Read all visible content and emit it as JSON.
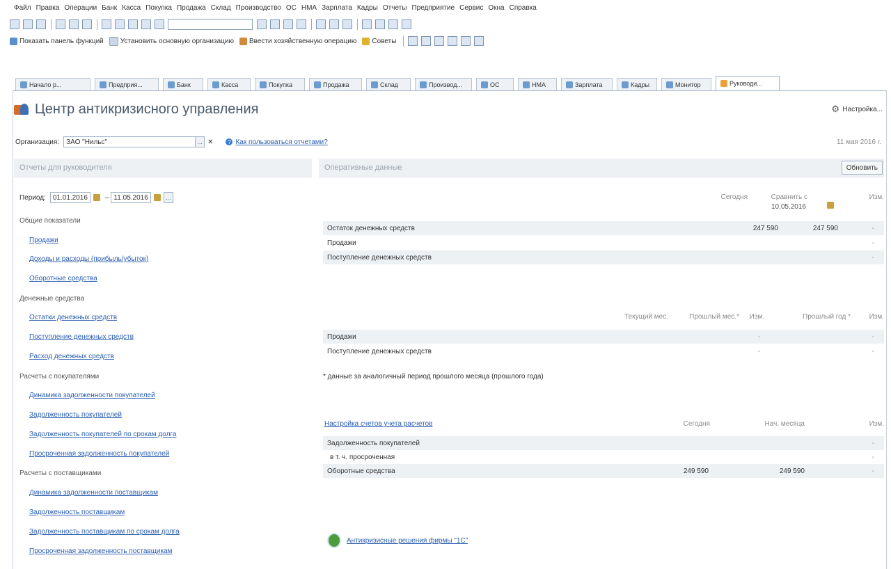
{
  "menu": [
    "Файл",
    "Правка",
    "Операции",
    "Банк",
    "Касса",
    "Покупка",
    "Продажа",
    "Склад",
    "Производство",
    "ОС",
    "НМА",
    "Зарплата",
    "Кадры",
    "Отчеты",
    "Предприятие",
    "Сервис",
    "Окна",
    "Справка"
  ],
  "toolbar2": {
    "show_panel": "Показать панель функций",
    "set_org": "Установить основную организацию",
    "enter_op": "Ввести хозяйственную операцию",
    "tips": "Советы"
  },
  "tabs": [
    "Начало р...",
    "Предприя...",
    "Банк",
    "Касса",
    "Покупка",
    "Продажа",
    "Склад",
    "Производ...",
    "ОС",
    "НМА",
    "Зарплата",
    "Кадры",
    "Монитор",
    "Руководи..."
  ],
  "header": {
    "title": "Центр антикризисного управления",
    "settings": "Настройка..."
  },
  "org": {
    "label": "Организация:",
    "value": "ЗАО \"Нильс\"",
    "help_link": "Как пользоваться отчетами?",
    "date": "11 мая 2016 г."
  },
  "left": {
    "title": "Отчеты для руководителя",
    "period_label": "Период:",
    "period_from": "01.01.2016",
    "period_to": "11.05.2016",
    "sections": [
      {
        "title": "Общие показатели",
        "links": [
          "Продажи",
          "Доходы и расходы (прибыль/убыток)",
          "Оборотные средства"
        ]
      },
      {
        "title": "Денежные средства",
        "links": [
          "Остатки денежных средств",
          "Поступление денежных средств",
          "Расход денежных средств"
        ]
      },
      {
        "title": "Расчеты с покупателями",
        "links": [
          "Динамика задолженности покупателей",
          "Задолженность покупателей",
          "Задолженность покупателей по срокам долга",
          "Просроченная задолженность покупателей"
        ]
      },
      {
        "title": "Расчеты с поставщиками",
        "links": [
          "Динамика задолженности поставщикам",
          "Задолженность поставщикам",
          "Задолженность поставщикам по срокам долга",
          "Просроченная задолженность поставщикам"
        ]
      }
    ]
  },
  "right": {
    "title": "Оперативные данные",
    "refresh": "Обновить",
    "t1": {
      "col_today": "Сегодня",
      "col_compare": "Сравнить с",
      "col_compare_date": "10.05.2016",
      "col_change": "Изм.",
      "rows": [
        {
          "label": "Остаток денежных средств",
          "today": "247 590",
          "compare": "247 590",
          "change": "-"
        },
        {
          "label": "Продажи",
          "today": "",
          "compare": "",
          "change": "-"
        },
        {
          "label": "Поступление денежных средств",
          "today": "",
          "compare": "",
          "change": "-"
        }
      ]
    },
    "t2": {
      "col_current": "Текущий мес.",
      "col_prev_month": "Прошлый мес.*",
      "col_change": "Изм.",
      "col_prev_year": "Прошлый год *",
      "col_change2": "Изм.",
      "rows": [
        {
          "label": "Продажи",
          "change": "-",
          "change2": "-"
        },
        {
          "label": "Поступление денежных средств",
          "change": "-",
          "change2": "-"
        }
      ]
    },
    "note": "* данные за аналогичный период прошлого месяца (прошлого года)",
    "t3": {
      "settings_link": "Настройка счетов учета расчетов",
      "col_today": "Сегодня",
      "col_month_start": "Нач. месяца",
      "col_change": "Изм.",
      "rows": [
        {
          "label": "Задолженность покупателей",
          "today": "",
          "start": "",
          "change": "-"
        },
        {
          "label": "в т. ч. просроченная",
          "today": "",
          "start": "",
          "change": "-"
        },
        {
          "label": "Оборотные средства",
          "today": "249 590",
          "start": "249 590",
          "change": "-"
        }
      ]
    },
    "anti_link": "Антикризисные решения фирмы \"1С\""
  }
}
